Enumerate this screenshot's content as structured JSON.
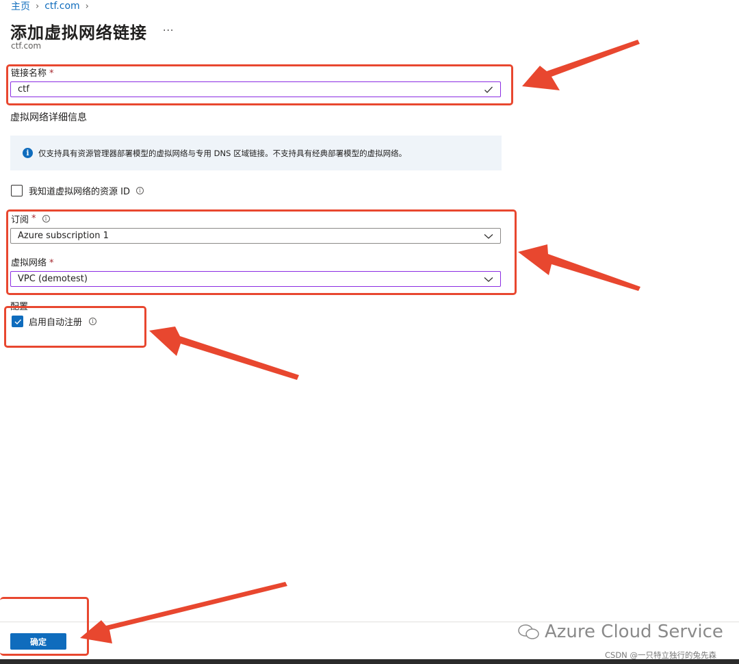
{
  "breadcrumb": {
    "home": "主页",
    "zone": "ctf.com"
  },
  "page": {
    "title": "添加虚拟网络链接",
    "more": "...",
    "subtitle": "ctf.com"
  },
  "link_name": {
    "label": "链接名称",
    "required_mark": "*",
    "value": "ctf"
  },
  "vnet_section": {
    "title": "虚拟网络详细信息"
  },
  "info": {
    "text": "仅支持具有资源管理器部署模型的虚拟网络与专用 DNS 区域链接。不支持具有经典部署模型的虚拟网络。",
    "icon": "info-icon"
  },
  "resource_id_checkbox": {
    "label": "我知道虚拟网络的资源 ID",
    "checked": false
  },
  "subscription": {
    "label": "订阅",
    "required_mark": "*",
    "value": "Azure subscription 1"
  },
  "virtual_network": {
    "label": "虚拟网络",
    "required_mark": "*",
    "value": "VPC (demotest)"
  },
  "config": {
    "title": "配置",
    "auto_register_label": "启用自动注册",
    "auto_register_checked": true
  },
  "footer": {
    "confirm_label": "确定"
  },
  "watermark": {
    "text": "Azure Cloud Service",
    "credit": "CSDN @一只特立独行的兔先森"
  },
  "colors": {
    "accent": "#0f6cbd",
    "highlight": "#e8472f",
    "required": "#a4262c",
    "info_bg": "#eff4f9"
  }
}
